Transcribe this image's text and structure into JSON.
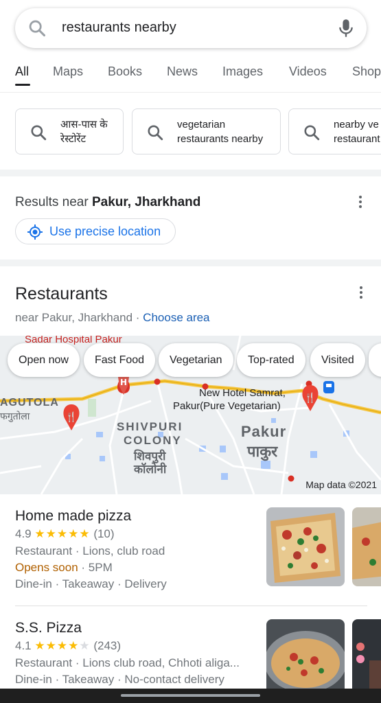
{
  "search": {
    "query": "restaurants nearby"
  },
  "tabs": [
    {
      "label": "All"
    },
    {
      "label": "Maps"
    },
    {
      "label": "Books"
    },
    {
      "label": "News"
    },
    {
      "label": "Images"
    },
    {
      "label": "Videos"
    },
    {
      "label": "Shop"
    }
  ],
  "related": [
    {
      "line1": "आस-पास के",
      "line2": "रेस्टोरेंट"
    },
    {
      "line1": "vegetarian",
      "line2": "restaurants nearby"
    },
    {
      "line1": "nearby ve",
      "line2": "restaurant"
    }
  ],
  "location": {
    "prefix": "Results near ",
    "place": "Pakur, Jharkhand",
    "precise_label": "Use precise location"
  },
  "restaurants_card": {
    "title": "Restaurants",
    "near_text": "near Pakur, Jharkhand · ",
    "choose_area": "Choose area"
  },
  "map": {
    "filters": [
      "Open now",
      "Fast Food",
      "Vegetarian",
      "Top-rated",
      "Visited"
    ],
    "labels": {
      "sadar": "Sadar Hospital Pakur",
      "agutola": "AGUTOLA",
      "agutola_hi": "फगुतोला",
      "shivpuri1": "SHIVPURI",
      "shivpuri2": "COLONY",
      "shivpuri_hi1": "शिवपुरी",
      "shivpuri_hi2": "कॉलोनी",
      "hotel1": "New Hotel Samrat,",
      "hotel2": "Pakur(Pure Vegetarian)",
      "pakur": "Pakur",
      "pakur_hi": "पाकुर"
    },
    "attribution": "Map data ©2021"
  },
  "listings": [
    {
      "name": "Home made pizza",
      "rating": "4.9",
      "stars": 5,
      "reviews": "(10)",
      "line1": "Restaurant · Lions, club road",
      "status": "Opens soon",
      "status_rest": " · 5PM",
      "line3": "Dine-in · Takeaway · Delivery"
    },
    {
      "name": "S.S. Pizza",
      "rating": "4.1",
      "stars": 4,
      "reviews": "(243)",
      "line1": "Restaurant · Lions club road, Chhoti aliga...",
      "line3": "Dine-in · Takeaway · No-contact delivery"
    }
  ],
  "colors": {
    "accent": "#1a73e8",
    "star": "#fbbc04",
    "status_orange": "#b06000",
    "map_pin": "#d93025"
  }
}
